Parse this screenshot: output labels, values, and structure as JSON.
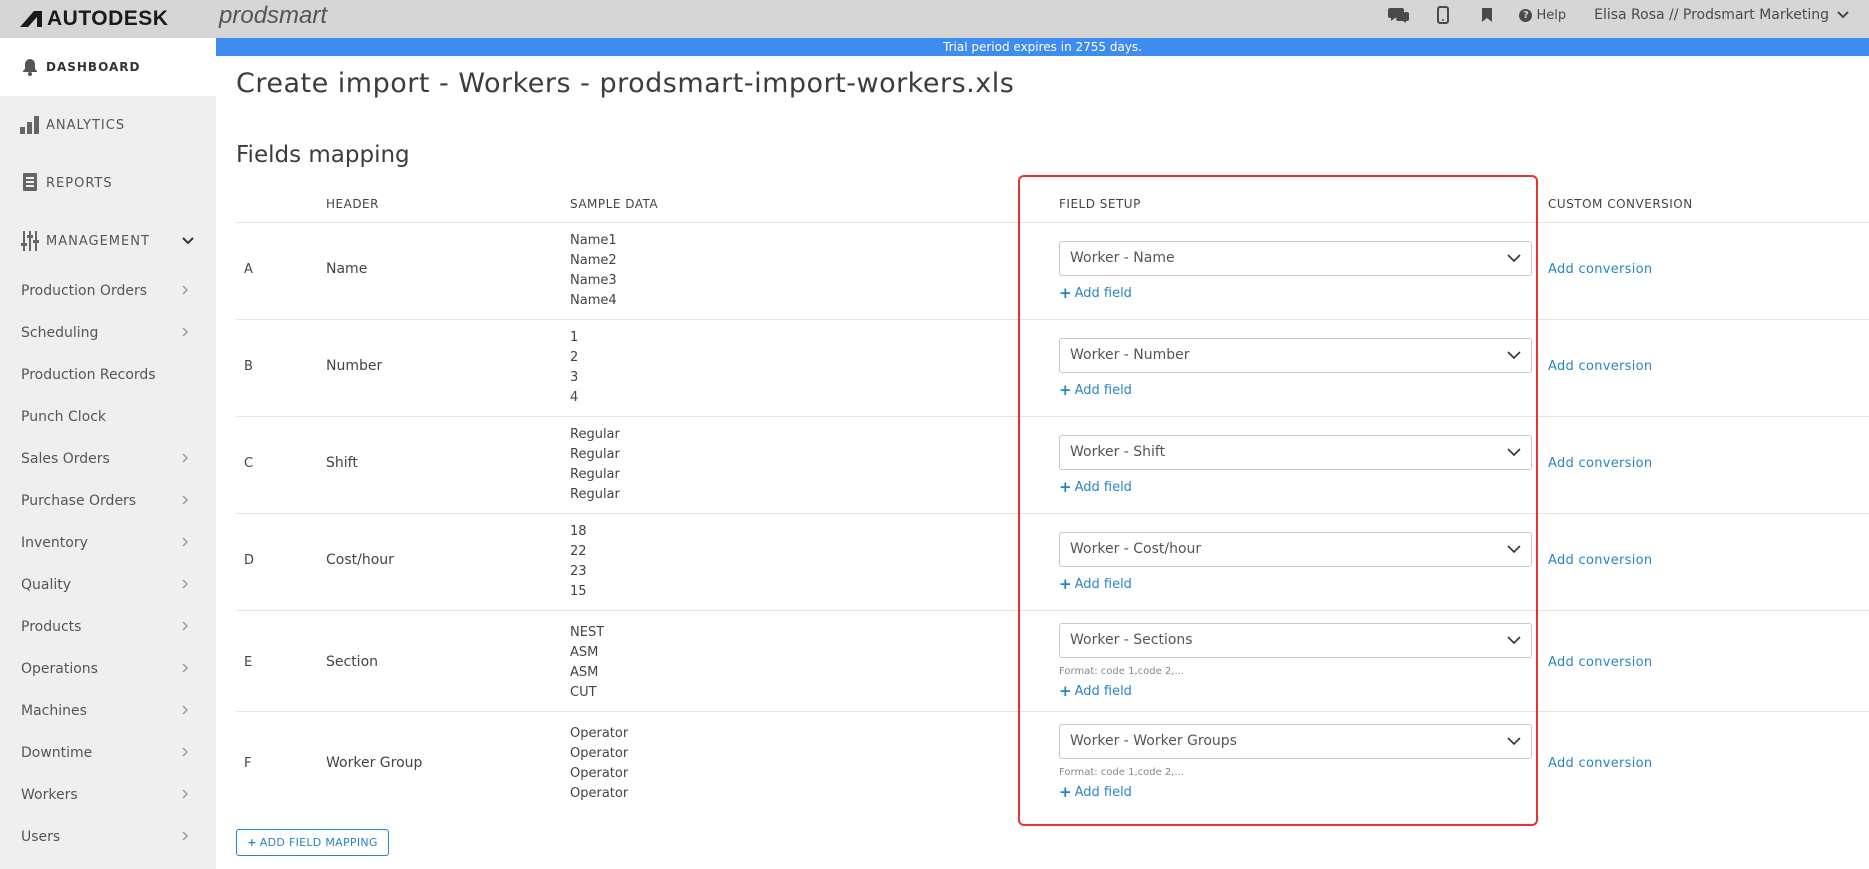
{
  "topbar": {
    "brand": "AUTODESK",
    "product": "prodsmart",
    "icons": [
      "chat-icon",
      "mobile-icon",
      "bookmark-icon"
    ],
    "help_label": "Help",
    "user_label": "Elisa Rosa // Prodsmart Marketing"
  },
  "banner": {
    "text": "Trial period expires in 2755 days."
  },
  "sidebar": {
    "dashboard": "DASHBOARD",
    "analytics": "ANALYTICS",
    "reports": "REPORTS",
    "management": "MANAGEMENT",
    "items": [
      {
        "label": "Production Orders",
        "has_submenu": true
      },
      {
        "label": "Scheduling",
        "has_submenu": true
      },
      {
        "label": "Production Records",
        "has_submenu": false
      },
      {
        "label": "Punch Clock",
        "has_submenu": false
      },
      {
        "label": "Sales Orders",
        "has_submenu": true
      },
      {
        "label": "Purchase Orders",
        "has_submenu": true
      },
      {
        "label": "Inventory",
        "has_submenu": true
      },
      {
        "label": "Quality",
        "has_submenu": true
      },
      {
        "label": "Products",
        "has_submenu": true
      },
      {
        "label": "Operations",
        "has_submenu": true
      },
      {
        "label": "Machines",
        "has_submenu": true
      },
      {
        "label": "Downtime",
        "has_submenu": true
      },
      {
        "label": "Workers",
        "has_submenu": true
      },
      {
        "label": "Users",
        "has_submenu": true
      }
    ]
  },
  "main": {
    "title": "Create import - Workers - prodsmart-import-workers.xls",
    "section_title": "Fields mapping",
    "columns": {
      "header": "HEADER",
      "sample_data": "SAMPLE DATA",
      "field_setup": "FIELD SETUP",
      "custom_conversion": "CUSTOM CONVERSION"
    },
    "add_field_label": "Add field",
    "add_conversion_label": "Add conversion",
    "format_hint": "Format: code 1,code 2,...",
    "rows": [
      {
        "letter": "A",
        "header": "Name",
        "samples": [
          "Name1",
          "Name2",
          "Name3",
          "Name4"
        ],
        "field": "Worker - Name",
        "has_format": false
      },
      {
        "letter": "B",
        "header": "Number",
        "samples": [
          "1",
          "2",
          "3",
          "4"
        ],
        "field": "Worker - Number",
        "has_format": false
      },
      {
        "letter": "C",
        "header": "Shift",
        "samples": [
          "Regular",
          "Regular",
          "Regular",
          "Regular"
        ],
        "field": "Worker - Shift",
        "has_format": false
      },
      {
        "letter": "D",
        "header": "Cost/hour",
        "samples": [
          "18",
          "22",
          "23",
          "15"
        ],
        "field": "Worker - Cost/hour",
        "has_format": false
      },
      {
        "letter": "E",
        "header": "Section",
        "samples": [
          "NEST",
          "ASM",
          "ASM",
          "CUT"
        ],
        "field": "Worker - Sections",
        "has_format": true
      },
      {
        "letter": "F",
        "header": "Worker Group",
        "samples": [
          "Operator",
          "Operator",
          "Operator",
          "Operator"
        ],
        "field": "Worker - Worker Groups",
        "has_format": true
      }
    ],
    "add_mapping_label": "ADD FIELD MAPPING"
  },
  "colors": {
    "accent_blue": "#2a84c4",
    "banner_blue": "#3f8cf0",
    "highlight_red": "#e63333",
    "sidebar_bg": "#efefef",
    "topbar_bg": "#d6d6d6"
  }
}
